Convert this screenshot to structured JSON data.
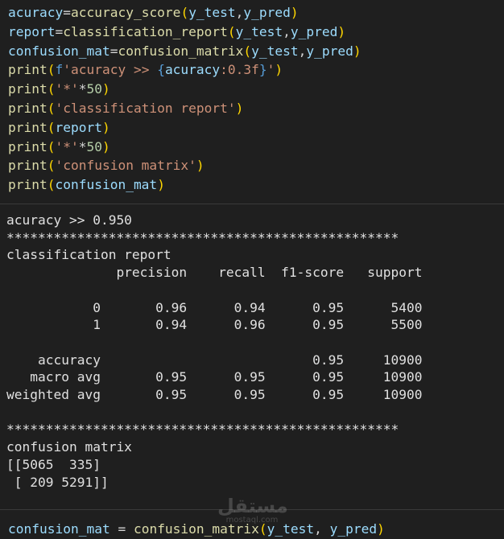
{
  "code_cell": {
    "lines": [
      [
        {
          "t": "acuracy",
          "c": "v"
        },
        {
          "t": "=",
          "c": "op"
        },
        {
          "t": "accuracy_score",
          "c": "fn"
        },
        {
          "t": "(",
          "c": "p"
        },
        {
          "t": "y_test",
          "c": "v"
        },
        {
          "t": ",",
          "c": "op"
        },
        {
          "t": "y_pred",
          "c": "v"
        },
        {
          "t": ")",
          "c": "p"
        }
      ],
      [
        {
          "t": "report",
          "c": "v"
        },
        {
          "t": "=",
          "c": "op"
        },
        {
          "t": "classification_report",
          "c": "fn"
        },
        {
          "t": "(",
          "c": "p"
        },
        {
          "t": "y_test",
          "c": "v"
        },
        {
          "t": ",",
          "c": "op"
        },
        {
          "t": "y_pred",
          "c": "v"
        },
        {
          "t": ")",
          "c": "p"
        }
      ],
      [
        {
          "t": "confusion_mat",
          "c": "v"
        },
        {
          "t": "=",
          "c": "op"
        },
        {
          "t": "confusion_matrix",
          "c": "fn"
        },
        {
          "t": "(",
          "c": "p"
        },
        {
          "t": "y_test",
          "c": "v"
        },
        {
          "t": ",",
          "c": "op"
        },
        {
          "t": "y_pred",
          "c": "v"
        },
        {
          "t": ")",
          "c": "p"
        }
      ],
      [
        {
          "t": "print",
          "c": "fn"
        },
        {
          "t": "(",
          "c": "p"
        },
        {
          "t": "f",
          "c": "k"
        },
        {
          "t": "'acuracy >> ",
          "c": "s"
        },
        {
          "t": "{",
          "c": "k"
        },
        {
          "t": "acuracy",
          "c": "v"
        },
        {
          "t": ":0.3f",
          "c": "s"
        },
        {
          "t": "}",
          "c": "k"
        },
        {
          "t": "'",
          "c": "s"
        },
        {
          "t": ")",
          "c": "p"
        }
      ],
      [
        {
          "t": "print",
          "c": "fn"
        },
        {
          "t": "(",
          "c": "p"
        },
        {
          "t": "'*'",
          "c": "s"
        },
        {
          "t": "*",
          "c": "op"
        },
        {
          "t": "50",
          "c": "n"
        },
        {
          "t": ")",
          "c": "p"
        }
      ],
      [
        {
          "t": "print",
          "c": "fn"
        },
        {
          "t": "(",
          "c": "p"
        },
        {
          "t": "'classification report'",
          "c": "s"
        },
        {
          "t": ")",
          "c": "p"
        }
      ],
      [
        {
          "t": "print",
          "c": "fn"
        },
        {
          "t": "(",
          "c": "p"
        },
        {
          "t": "report",
          "c": "v"
        },
        {
          "t": ")",
          "c": "p"
        }
      ],
      [
        {
          "t": "print",
          "c": "fn"
        },
        {
          "t": "(",
          "c": "p"
        },
        {
          "t": "'*'",
          "c": "s"
        },
        {
          "t": "*",
          "c": "op"
        },
        {
          "t": "50",
          "c": "n"
        },
        {
          "t": ")",
          "c": "p"
        }
      ],
      [
        {
          "t": "print",
          "c": "fn"
        },
        {
          "t": "(",
          "c": "p"
        },
        {
          "t": "'confusion matrix'",
          "c": "s"
        },
        {
          "t": ")",
          "c": "p"
        }
      ],
      [
        {
          "t": "print",
          "c": "fn"
        },
        {
          "t": "(",
          "c": "p"
        },
        {
          "t": "confusion_mat",
          "c": "v"
        },
        {
          "t": ")",
          "c": "p"
        }
      ]
    ]
  },
  "output_cell": {
    "lines": [
      "acuracy >> 0.950",
      "**************************************************",
      "classification report",
      "              precision    recall  f1-score   support",
      "",
      "           0       0.96      0.94      0.95      5400",
      "           1       0.94      0.96      0.95      5500",
      "",
      "    accuracy                           0.95     10900",
      "   macro avg       0.95      0.95      0.95     10900",
      "weighted avg       0.95      0.95      0.95     10900",
      "",
      "**************************************************",
      "confusion matrix",
      "[[5065  335]",
      " [ 209 5291]]"
    ]
  },
  "next_cell": {
    "line": [
      {
        "t": "confusion_mat",
        "c": "v"
      },
      {
        "t": " = ",
        "c": "op"
      },
      {
        "t": "confusion_matrix",
        "c": "fn"
      },
      {
        "t": "(",
        "c": "p"
      },
      {
        "t": "y_test",
        "c": "v"
      },
      {
        "t": ", ",
        "c": "op"
      },
      {
        "t": "y_pred",
        "c": "v"
      },
      {
        "t": ")",
        "c": "p"
      }
    ]
  },
  "watermark": {
    "arabic": "مستقل",
    "latin": "mostaql.com"
  }
}
